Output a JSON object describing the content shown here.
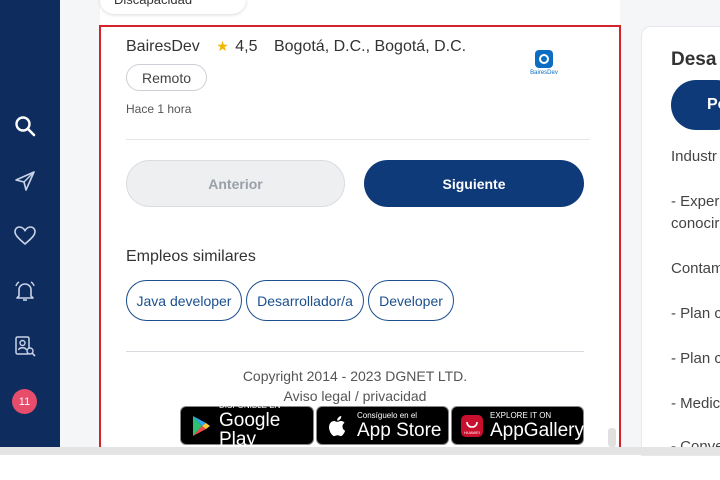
{
  "top_chip": {
    "label": "Discapacidad"
  },
  "company": {
    "name": "BairesDev",
    "rating": "4,5",
    "location": "Bogotá, D.C., Bogotá, D.C.",
    "logo_text": "BairesDev"
  },
  "tags": {
    "modality": "Remoto"
  },
  "posted": "Hace 1 hora",
  "nav": {
    "prev_label": "Anterior",
    "next_label": "Siguiente"
  },
  "similar": {
    "title": "Empleos similares",
    "items": [
      {
        "label": "Java developer"
      },
      {
        "label": "Desarrollador/a"
      },
      {
        "label": "Developer"
      }
    ]
  },
  "footer": {
    "copyright": "Copyright 2014 - 2023 DGNET LTD.",
    "legal": "Aviso legal / privacidad"
  },
  "stores": {
    "google": {
      "small": "DISPONIBLE EN",
      "big": "Google Play"
    },
    "apple": {
      "small": "Consíguelo en el",
      "big": "App Store"
    },
    "huawei": {
      "small": "EXPLORE IT ON",
      "big": "AppGallery"
    }
  },
  "right_panel": {
    "title": "Desa",
    "button": "Po",
    "lines": [
      "Industr",
      "- Exper",
      "conocir",
      "Contam",
      "- Plan c",
      "- Plan c",
      "- Medic",
      "- Conve"
    ]
  },
  "sidebar": {
    "alerts_count": "11"
  },
  "colors": {
    "navy": "#0f2c5f",
    "primary": "#0f3a7a",
    "badge": "#e74c6b",
    "selection": "#d6232b"
  }
}
